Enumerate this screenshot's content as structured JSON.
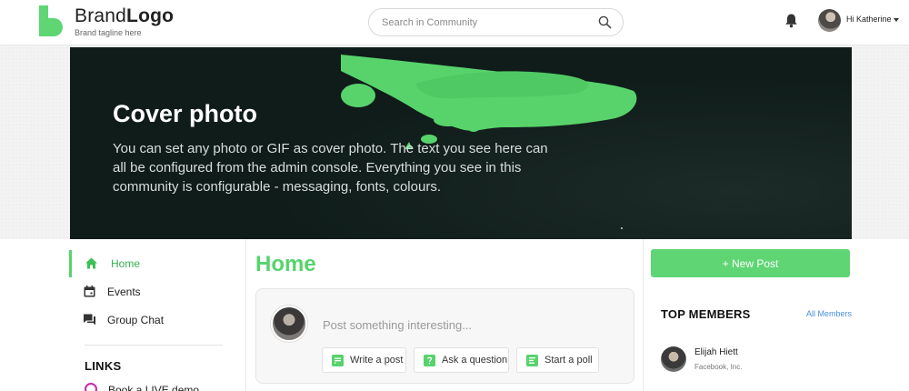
{
  "header": {
    "brand_name_regular": "Brand",
    "brand_name_bold": "Logo",
    "brand_tagline": "Brand tagline here",
    "search_placeholder": "Search in Community",
    "greeting": "Hi Katherine"
  },
  "cover": {
    "title": "Cover photo",
    "text": "You can set any photo or GIF as cover photo. The text you see here can all be configured from the admin console. Everything you see in this community is configurable - messaging, fonts, colours."
  },
  "sidebar": {
    "items": [
      {
        "label": "Home",
        "icon": "home-icon",
        "active": true
      },
      {
        "label": "Events",
        "icon": "calendar-icon",
        "active": false
      },
      {
        "label": "Group Chat",
        "icon": "chat-icon",
        "active": false
      }
    ],
    "links_heading": "LINKS",
    "links": [
      {
        "label": "Book a LIVE demo",
        "icon": "circle-link-icon"
      }
    ]
  },
  "main": {
    "title": "Home",
    "composer_placeholder": "Post something interesting...",
    "actions": [
      {
        "label": "Write a post",
        "icon": "write-icon"
      },
      {
        "label": "Ask a question",
        "icon": "question-icon"
      },
      {
        "label": "Start a poll",
        "icon": "poll-icon"
      }
    ]
  },
  "right": {
    "new_post_label": "+  New Post",
    "top_members_heading": "TOP MEMBERS",
    "all_members_link": "All Members",
    "members": [
      {
        "name": "Elijah Hiett",
        "company": "Facebook, Inc."
      }
    ]
  },
  "colors": {
    "accent": "#57d36d",
    "cover_background": "#0f1c1a",
    "link": "#4a90e2"
  }
}
